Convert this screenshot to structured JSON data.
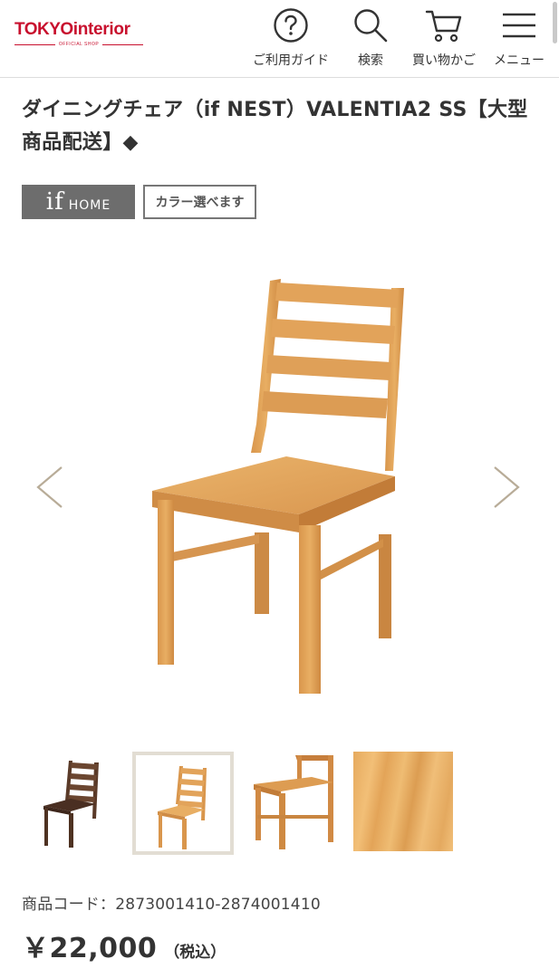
{
  "header": {
    "logo_brand_tokyo": "TOKYO",
    "logo_brand_interior": "interior",
    "logo_sub": "OFFICIAL SHOP",
    "nav": {
      "guide": "ご利用ガイド",
      "search": "検索",
      "cart": "買い物かご",
      "menu": "メニュー"
    }
  },
  "product": {
    "title": "ダイニングチェア（if NEST）VALENTIA2 SS【大型商品配送】◆",
    "badge_if": "if",
    "badge_home": "HOME",
    "badge_color": "カラー選べます",
    "code": "商品コード：2873001410-2874001410",
    "price": "￥22,000",
    "tax": "（税込）"
  },
  "thumbnails": [
    {
      "name": "dark-brown-chair",
      "selected": false
    },
    {
      "name": "natural-chair",
      "selected": true
    },
    {
      "name": "natural-chair-side",
      "selected": false
    },
    {
      "name": "wood-texture",
      "selected": false
    }
  ],
  "colors": {
    "brand_red": "#c8102e",
    "wood_light": "#e3a458",
    "wood_dark": "#5a3a28",
    "badge_gray": "#6d6d6d"
  }
}
